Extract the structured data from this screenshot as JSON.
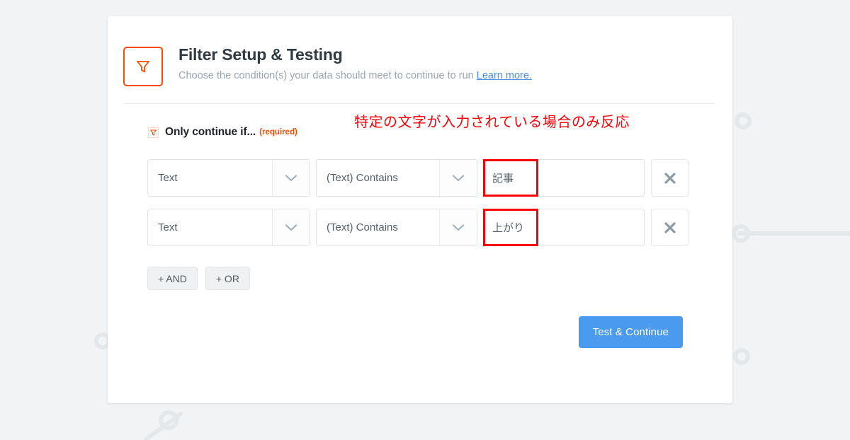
{
  "header": {
    "icon": "funnel-icon",
    "title": "Filter Setup & Testing",
    "subtitle_text": "Choose the condition(s) your data should meet to continue to run",
    "learn_more_label": "Learn more."
  },
  "condition_section": {
    "icon": "funnel-small-icon",
    "label": "Only continue if...",
    "required_tag": "(required)"
  },
  "annotation": {
    "text": "特定の文字が入力されている場合のみ反応",
    "color": "#fb0007"
  },
  "filter_rows": [
    {
      "field": "Text",
      "operator": "(Text) Contains",
      "value": "記事",
      "remove_label": "✕",
      "highlighted": true
    },
    {
      "field": "Text",
      "operator": "(Text) Contains",
      "value": "上がり",
      "remove_label": "✕",
      "highlighted": true
    }
  ],
  "add_buttons": [
    {
      "label": "+ AND"
    },
    {
      "label": "+ OR"
    }
  ],
  "footer": {
    "primary_label": "Test & Continue"
  },
  "colors": {
    "accent_orange": "#ff4a00",
    "link_blue": "#4a90e2",
    "primary_blue": "#4a9bf0",
    "annotation_red": "#fb0007",
    "page_background": "#f1f3f5",
    "card_background": "#ffffff"
  }
}
